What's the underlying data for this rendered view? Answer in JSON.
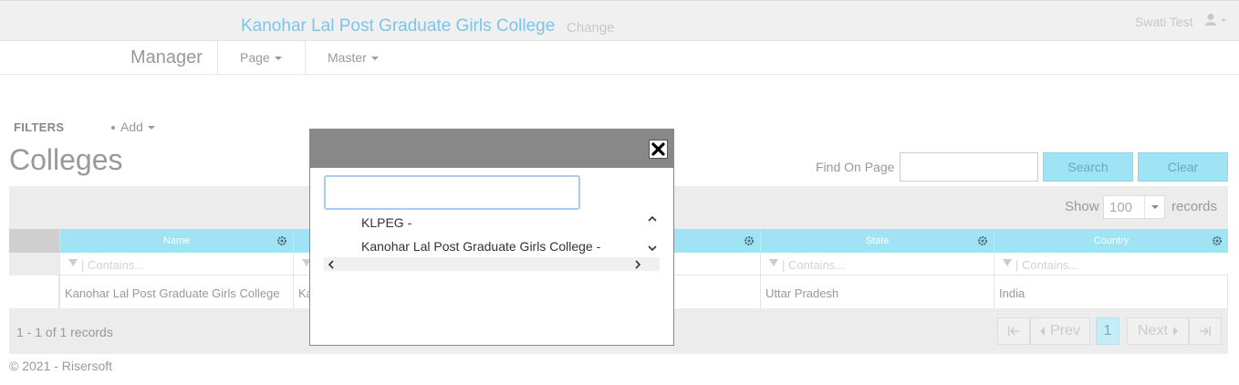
{
  "header": {
    "college_title": "Kanohar Lal Post Graduate Girls College",
    "change_link": "Change",
    "user_name": "Swati Test"
  },
  "nav": {
    "brand": "Manager",
    "items": [
      {
        "label": "Page"
      },
      {
        "label": "Master"
      }
    ]
  },
  "filters": {
    "label": "FILTERS",
    "add_label": "Add"
  },
  "page": {
    "title": "Colleges",
    "find_label": "Find On Page",
    "find_value": "",
    "search_button": "Search",
    "clear_button": "Clear"
  },
  "grid": {
    "show_label": "Show",
    "page_size": "100",
    "records_label": "records",
    "columns": [
      "Name",
      "",
      "",
      "State",
      "Country"
    ],
    "filter_placeholder": "| Contains...",
    "rows": [
      {
        "cells": [
          "Kanohar Lal Post Graduate Girls College",
          "Ka",
          "",
          "Uttar Pradesh",
          "India"
        ]
      }
    ],
    "summary": "1 - 1 of 1 records",
    "pager": {
      "prev": "Prev",
      "current": "1",
      "next": "Next"
    }
  },
  "footer": {
    "text": "© 2021 - Risersoft"
  },
  "modal": {
    "search_value": "",
    "options": [
      "KLPEG -",
      "Kanohar Lal Post Graduate Girls College -"
    ]
  },
  "colors": {
    "accent": "#9fe3f5",
    "title_blue": "#7cc4e8",
    "modal_header": "#888888"
  }
}
